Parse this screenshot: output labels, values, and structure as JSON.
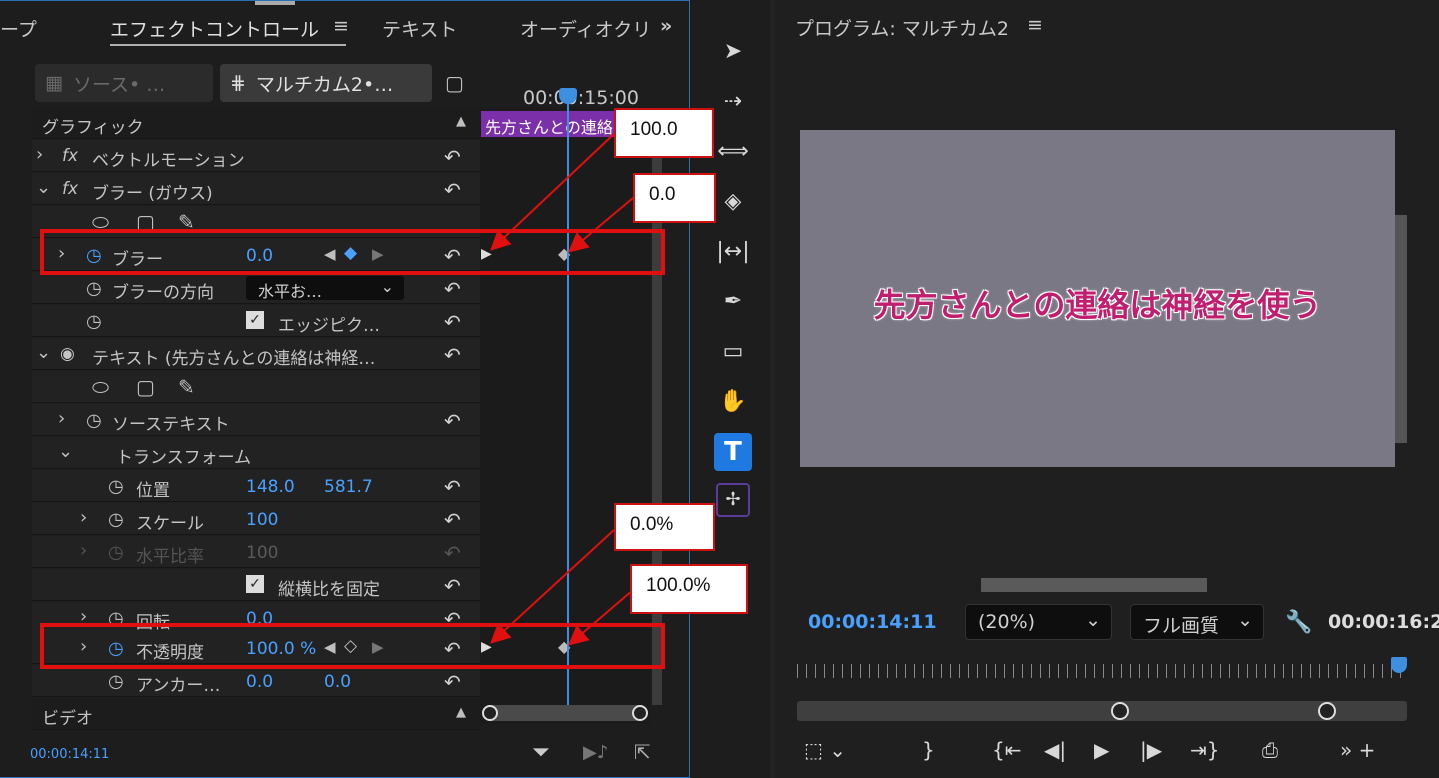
{
  "effect_controls": {
    "tabs": {
      "prev": "ープ",
      "active": "エフェクトコントロール",
      "menu": "≡",
      "text": "テキスト",
      "audio": "オーディオクリ",
      "more": "»"
    },
    "source_button": "ソース• …",
    "multicam_button": "マルチカム2•…",
    "timecode": "00:00:15:00",
    "clip_label": "先方さんとの連絡",
    "section_graphic": "グラフィック",
    "vector_motion": "ベクトルモーション",
    "blur_effect": "ブラー (ガウス)",
    "blur_label": "ブラー",
    "blur_value": "0.0",
    "blur_direction_label": "ブラーの方向",
    "blur_direction_value": "水平お…",
    "edge_pixel": "エッジピク…",
    "text_layer": "テキスト (先方さんとの連絡は神経…",
    "source_text": "ソーステキスト",
    "transform": "トランスフォーム",
    "position_label": "位置",
    "position_x": "148.0",
    "position_y": "581.7",
    "scale_label": "スケール",
    "scale_value": "100",
    "h_ratio_label": "水平比率",
    "h_ratio_value": "100",
    "lock_ratio": "縦横比を固定",
    "rotation_label": "回転",
    "rotation_value": "0.0",
    "opacity_label": "不透明度",
    "opacity_value": "100.0 %",
    "anchor_label": "アンカー…",
    "anchor_x": "0.0",
    "anchor_y": "0.0",
    "section_video": "ビデオ",
    "bottom_timecode": "00:00:14:11"
  },
  "program": {
    "title": "プログラム: マルチカム2",
    "menu": "≡",
    "caption": "先方さんとの連絡は神経を使う",
    "current_time": "00:00:14:11",
    "zoom": "(20%)",
    "quality": "フル画質",
    "duration": "00:00:16:2"
  },
  "annotations": {
    "blur_start": "100.0",
    "blur_end": "0.0",
    "opacity_start": "0.0%",
    "opacity_end": "100.0%"
  },
  "colors": {
    "accent": "#3d8fe0",
    "clip": "#7b2fa8",
    "highlight": "#e01010",
    "caption": "#c01e6e"
  }
}
